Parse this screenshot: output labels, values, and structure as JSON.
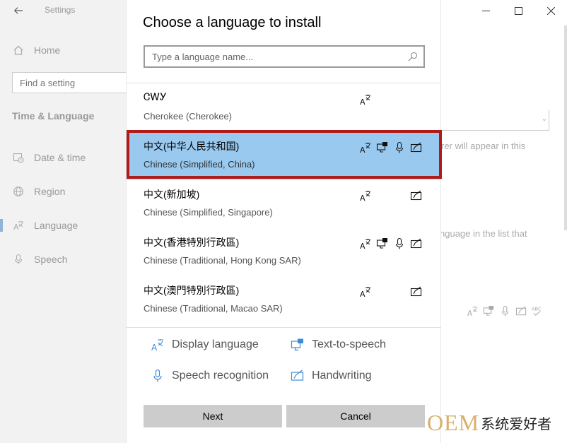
{
  "settings": {
    "app_title": "Settings",
    "home_label": "Home",
    "search_placeholder": "Find a setting",
    "section_title": "Time & Language",
    "nav": [
      {
        "label": "Date & time",
        "icon": "calendar-clock-icon"
      },
      {
        "label": "Region",
        "icon": "globe-icon"
      },
      {
        "label": "Language",
        "icon": "language-icon",
        "active": true
      },
      {
        "label": "Speech",
        "icon": "microphone-icon"
      }
    ],
    "background_texts": {
      "line1": "rer will appear in this",
      "line2": "nguage in the list that"
    }
  },
  "dialog": {
    "title": "Choose a language to install",
    "search_placeholder": "Type a language name...",
    "languages": [
      {
        "native": "ᏣᎳᎩ",
        "english": "Cherokee (Cherokee)",
        "features": [
          "display-language"
        ]
      },
      {
        "native": "中文(中华人民共和国)",
        "english": "Chinese (Simplified, China)",
        "features": [
          "display-language",
          "text-to-speech",
          "speech-recognition",
          "handwriting"
        ],
        "selected": true
      },
      {
        "native": "中文(新加坡)",
        "english": "Chinese (Simplified, Singapore)",
        "features": [
          "display-language",
          "handwriting"
        ]
      },
      {
        "native": "中文(香港特別行政區)",
        "english": "Chinese (Traditional, Hong Kong SAR)",
        "features": [
          "display-language",
          "text-to-speech",
          "speech-recognition",
          "handwriting"
        ]
      },
      {
        "native": "中文(澳門特別行政區)",
        "english": "Chinese (Traditional, Macao SAR)",
        "features": [
          "display-language",
          "handwriting"
        ]
      }
    ],
    "legend": {
      "display_language": "Display language",
      "text_to_speech": "Text-to-speech",
      "speech_recognition": "Speech recognition",
      "handwriting": "Handwriting"
    },
    "buttons": {
      "next": "Next",
      "cancel": "Cancel"
    },
    "colors": {
      "selected_row": "#99c9ef",
      "highlight_border": "#b11a17",
      "legend_icon": "#3b8ad9"
    }
  },
  "watermark": {
    "brand": "OEM",
    "text": "系统爱好者"
  }
}
